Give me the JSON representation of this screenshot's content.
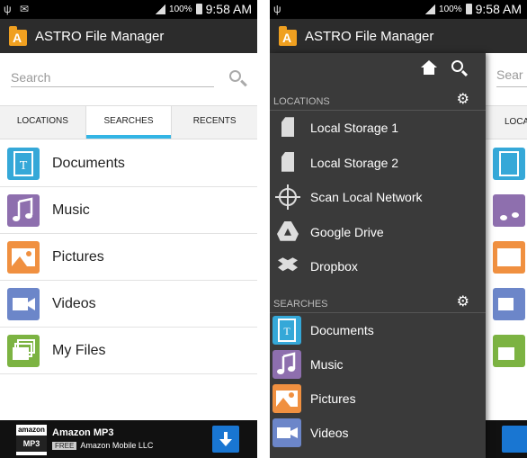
{
  "status_bar": {
    "notif_icons": "ψ ✉",
    "battery": "100%",
    "time": "9:58 AM"
  },
  "app": {
    "title": "ASTRO File Manager",
    "icon_letter": "A"
  },
  "search": {
    "placeholder": "Search",
    "icon": "search-icon"
  },
  "tabs": [
    {
      "label": "LOCATIONS",
      "active": false
    },
    {
      "label": "SEARCHES",
      "active": true
    },
    {
      "label": "RECENTS",
      "active": false
    }
  ],
  "categories": [
    {
      "label": "Documents",
      "icon": "documents-icon",
      "color": "#35a8d8"
    },
    {
      "label": "Music",
      "icon": "music-icon",
      "color": "#8e6fae"
    },
    {
      "label": "Pictures",
      "icon": "pictures-icon",
      "color": "#f09040"
    },
    {
      "label": "Videos",
      "icon": "videos-icon",
      "color": "#6c86c9"
    },
    {
      "label": "My Files",
      "icon": "my-files-icon",
      "color": "#7cb342"
    }
  ],
  "ad": {
    "logo_top": "amazon",
    "logo_bottom": "MP3",
    "title": "Amazon MP3",
    "badge": "FREE",
    "publisher": "Amazon Mobile LLC",
    "icon": "download-icon"
  },
  "drawer": {
    "locations_header": "LOCATIONS",
    "locations": [
      {
        "label": "Local Storage 1",
        "icon": "sd-card-icon"
      },
      {
        "label": "Local Storage 2",
        "icon": "sd-card-icon"
      },
      {
        "label": "Scan Local Network",
        "icon": "network-target-icon"
      },
      {
        "label": "Google Drive",
        "icon": "google-drive-icon"
      },
      {
        "label": "Dropbox",
        "icon": "dropbox-icon"
      }
    ],
    "searches_header": "SEARCHES",
    "searches": [
      {
        "label": "Documents",
        "icon": "documents-icon"
      },
      {
        "label": "Music",
        "icon": "music-icon"
      },
      {
        "label": "Pictures",
        "icon": "pictures-icon"
      },
      {
        "label": "Videos",
        "icon": "videos-icon"
      }
    ]
  },
  "background_peek": {
    "search_text": "Sear",
    "tab_text": "LOCA"
  },
  "colors": {
    "action_bar": "#2c2c2c",
    "accent": "#33b5e5",
    "drawer": "#3a3a3a"
  }
}
